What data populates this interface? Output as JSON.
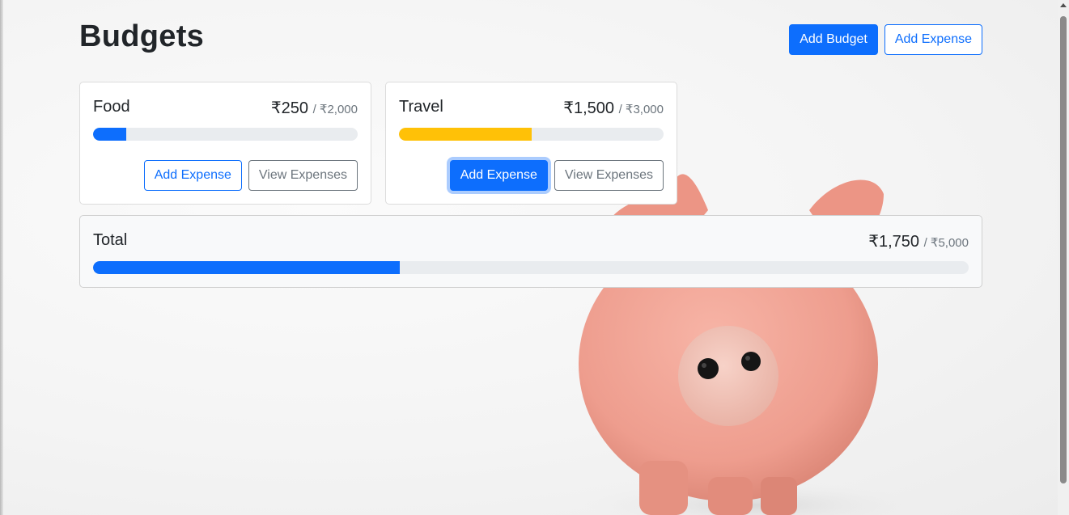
{
  "page": {
    "title": "Budgets",
    "add_budget_label": "Add Budget",
    "add_expense_label": "Add Expense"
  },
  "colors": {
    "primary": "#0d6efd",
    "warning": "#ffc107",
    "track": "#e9ecef"
  },
  "budgets": [
    {
      "name": "Food",
      "amount": "₹250",
      "max": "/ ₹2,000",
      "progress": 0.125,
      "bar_color": "#0d6efd",
      "add_expense_label": "Add Expense",
      "view_expenses_label": "View Expenses"
    },
    {
      "name": "Travel",
      "amount": "₹1,500",
      "max": "/ ₹3,000",
      "progress": 0.5,
      "bar_color": "#ffc107",
      "add_expense_label": "Add Expense",
      "view_expenses_label": "View Expenses"
    }
  ],
  "total": {
    "name": "Total",
    "amount": "₹1,750",
    "max": "/ ₹5,000",
    "progress": 0.35,
    "bar_color": "#0d6efd"
  }
}
